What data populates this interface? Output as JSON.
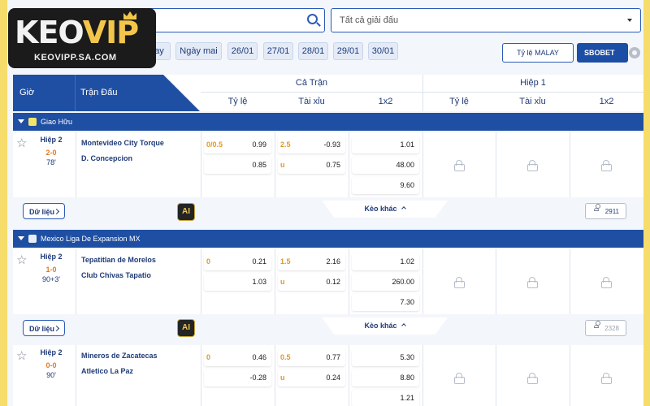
{
  "brand": {
    "logo_keo": "KEO",
    "logo_vip": "VIP",
    "url": "KEOVIPP.SA.COM"
  },
  "filters": {
    "league_select": "Tất cả giải đấu",
    "dates": [
      "ay",
      "Ngày mai",
      "26/01",
      "27/01",
      "28/01",
      "29/01",
      "30/01"
    ],
    "odds_type": "Tỷ lệ MALAY",
    "bookmaker": "SBOBET"
  },
  "table_header": {
    "time": "Giờ",
    "match": "Trận Đấu",
    "full_match": "Cả Trận",
    "first_half": "Hiệp 1",
    "cols": [
      "Tỷ lệ",
      "Tài xỉu",
      "1x2",
      "Tỷ lệ",
      "Tài xỉu",
      "1x2"
    ]
  },
  "leagues": [
    {
      "name": "Giao Hữu",
      "match": {
        "period": "Hiệp 2",
        "score": "2-0",
        "minute": "78'",
        "home": "Montevideo City Torque",
        "away": "D. Concepcion",
        "handicap": {
          "line": "0/0.5",
          "home": "0.99",
          "away": "0.85"
        },
        "over_under": {
          "line": "2.5",
          "over": "-0.93",
          "under_label": "u",
          "under": "0.75"
        },
        "x12": [
          "1.01",
          "48.00",
          "9.60"
        ],
        "data_label": "Dữ liệu",
        "ai_label": "AI",
        "more_label": "Kèo khác",
        "viewers": "2911"
      }
    },
    {
      "name": "Mexico Liga De Expansion MX",
      "match": {
        "period": "Hiệp 2",
        "score": "1-0",
        "minute": "90+3'",
        "home": "Tepatitlan de Morelos",
        "away": "Club Chivas Tapatio",
        "handicap": {
          "line": "0",
          "home": "0.21",
          "away": "1.03"
        },
        "over_under": {
          "line": "1.5",
          "over": "2.16",
          "under_label": "u",
          "under": "0.12"
        },
        "x12": [
          "1.02",
          "260.00",
          "7.30"
        ],
        "data_label": "Dữ liệu",
        "ai_label": "AI",
        "more_label": "Kèo khác",
        "viewers": "2328"
      },
      "match2": {
        "period": "Hiệp 2",
        "score": "0-0",
        "minute": "90'",
        "home": "Mineros de Zacatecas",
        "away": "Atletico La Paz",
        "handicap": {
          "line": "0",
          "home": "0.46",
          "away": "-0.28"
        },
        "over_under": {
          "line": "0.5",
          "over": "0.77",
          "under_label": "u",
          "under": "0.24"
        },
        "x12": [
          "5.30",
          "8.80",
          "1.21"
        ]
      }
    }
  ]
}
